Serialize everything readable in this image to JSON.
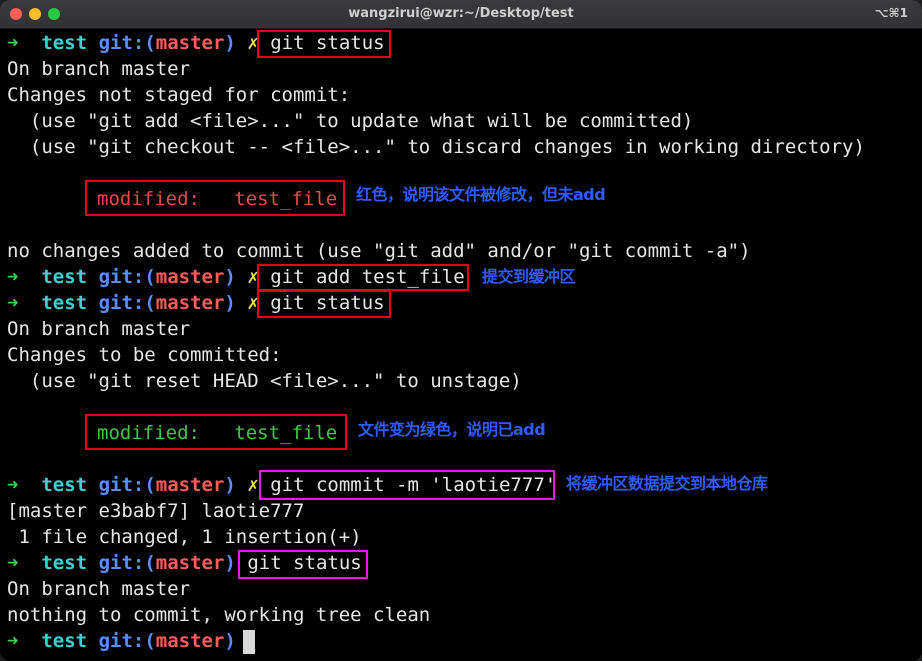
{
  "window": {
    "title": "wangzirui@wzr:~/Desktop/test",
    "shortcut": "⌥⌘1"
  },
  "prompt": {
    "arrow": "➜",
    "dir": "test",
    "git": "git:(",
    "branch": "master",
    "close": ")",
    "dirty": "✗"
  },
  "commands": {
    "cmd1": "git status",
    "cmd2": "git add test_file",
    "cmd3": "git status",
    "cmd4": "git commit -m 'laotie777'",
    "cmd5": "git status"
  },
  "output": {
    "o1": "On branch master",
    "o2": "Changes not staged for commit:",
    "o3": "  (use \"git add <file>...\" to update what will be committed)",
    "o4": "  (use \"git checkout -- <file>...\" to discard changes in working directory)",
    "o5": "modified:   test_file",
    "o6": "no changes added to commit (use \"git add\" and/or \"git commit -a\")",
    "o7": "On branch master",
    "o8": "Changes to be committed:",
    "o9": "  (use \"git reset HEAD <file>...\" to unstage)",
    "o10": "modified:   test_file",
    "o11": "[master e3babf7] laotie777",
    "o12": " 1 file changed, 1 insertion(+)",
    "o13": "On branch master",
    "o14": "nothing to commit, working tree clean"
  },
  "annotations": {
    "a1": "红色，说明该文件被修改，但未add",
    "a2": "提交到缓冲区",
    "a3": "文件变为绿色，说明已add",
    "a4": "将缓冲区数据提交到本地仓库"
  },
  "colors": {
    "red_box": "#e3001b",
    "magenta_box": "#e020e0",
    "note_text": "#2f5bff"
  }
}
